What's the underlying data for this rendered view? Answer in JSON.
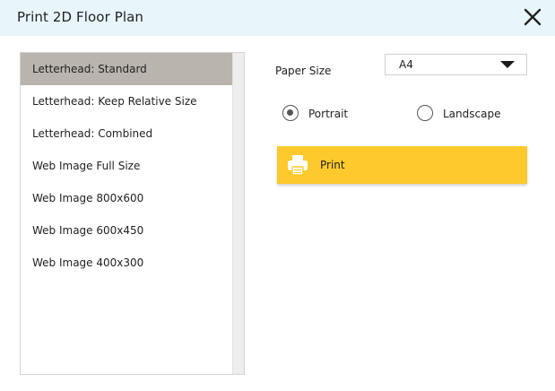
{
  "dialog": {
    "title": "Print 2D Floor Plan",
    "close_icon": "close-icon"
  },
  "colors": {
    "titlebar_bg": "#e8f6fc",
    "selected_item_bg": "#b9b4ad",
    "print_button_bg": "#fec92d"
  },
  "templates": {
    "selected_index": 0,
    "items": [
      {
        "label": "Letterhead: Standard"
      },
      {
        "label": "Letterhead: Keep Relative Size"
      },
      {
        "label": "Letterhead: Combined"
      },
      {
        "label": "Web Image Full Size"
      },
      {
        "label": "Web Image 800x600"
      },
      {
        "label": "Web Image 600x450"
      },
      {
        "label": "Web Image 400x300"
      }
    ]
  },
  "paper_size": {
    "label": "Paper Size",
    "selected": "A4",
    "chevron_icon": "chevron-down-icon"
  },
  "orientation": {
    "selected": "Portrait",
    "options": [
      {
        "label": "Portrait",
        "checked": true
      },
      {
        "label": "Landscape",
        "checked": false
      }
    ]
  },
  "print_button": {
    "label": "Print",
    "icon": "printer-icon"
  }
}
